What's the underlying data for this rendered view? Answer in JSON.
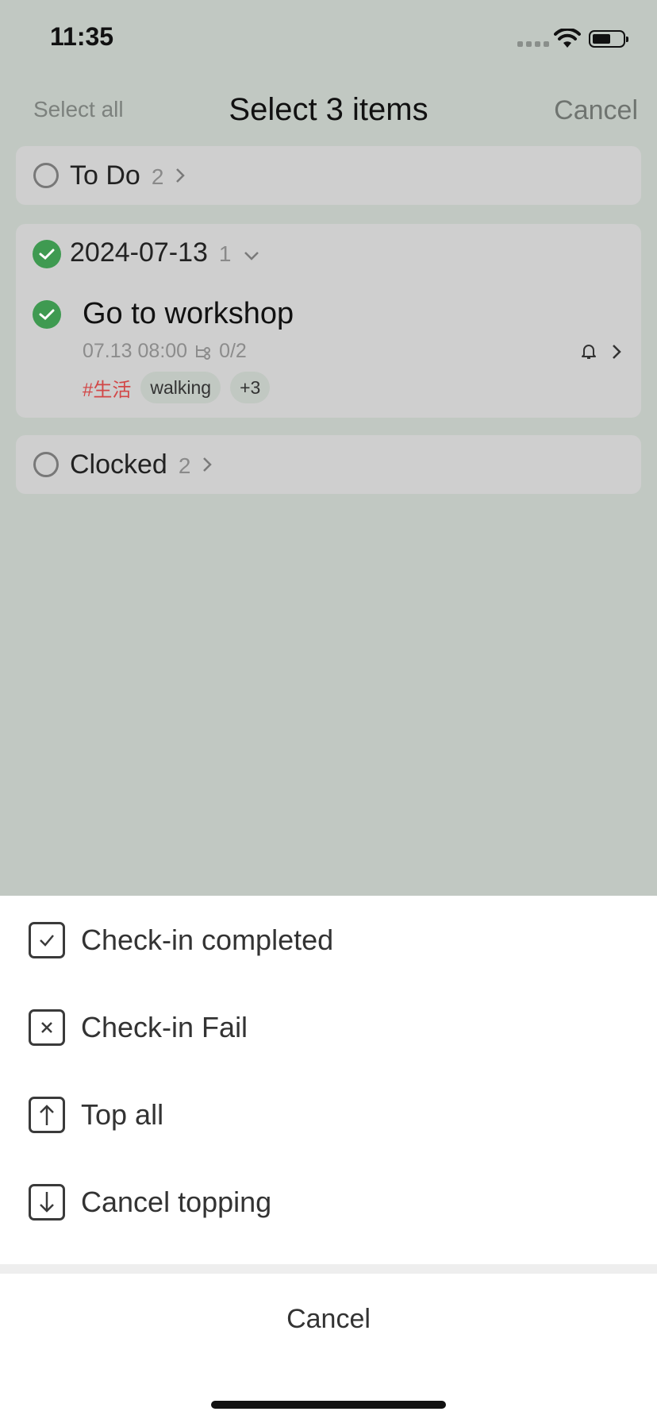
{
  "status": {
    "time": "11:35"
  },
  "nav": {
    "select_all": "Select all",
    "title": "Select 3 items",
    "cancel": "Cancel"
  },
  "groups": [
    {
      "label": "To Do",
      "count": "2",
      "checked": false
    },
    {
      "label": "2024-07-13",
      "count": "1",
      "checked": true
    },
    {
      "label": "Clocked",
      "count": "2",
      "checked": false
    }
  ],
  "task": {
    "title": "Go to workshop",
    "datetime": "07.13 08:00",
    "subtasks": "0/2",
    "tags": [
      "#生活",
      "walking",
      "+3"
    ]
  },
  "sheet": {
    "items": [
      {
        "label": "Check-in completed",
        "icon": "check-square-icon"
      },
      {
        "label": "Check-in Fail",
        "icon": "x-square-icon"
      },
      {
        "label": "Top all",
        "icon": "arrow-up-square-icon"
      },
      {
        "label": "Cancel topping",
        "icon": "arrow-down-square-icon"
      }
    ],
    "cancel": "Cancel"
  },
  "colors": {
    "overlay": "#c1c8c2",
    "check_green": "#3f9a51",
    "tag_red": "#d24747"
  }
}
